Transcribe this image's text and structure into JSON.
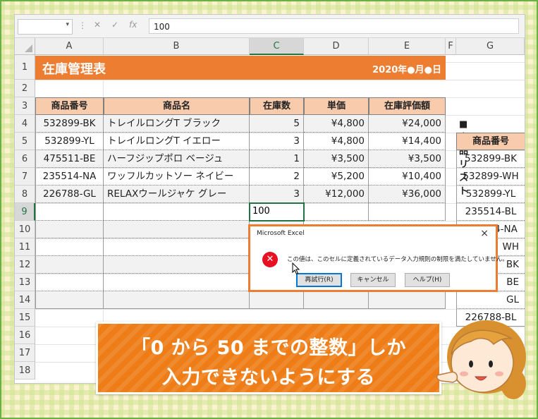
{
  "formula_bar": {
    "name_box": "",
    "formula": "100",
    "fx_label": "fx"
  },
  "columns": [
    "A",
    "B",
    "C",
    "D",
    "E",
    "F",
    "G"
  ],
  "rows": [
    "1",
    "2",
    "3",
    "4",
    "5",
    "6",
    "7",
    "8",
    "9",
    "10",
    "11",
    "12",
    "13",
    "14",
    "15",
    "16",
    "17",
    "18"
  ],
  "sheet": {
    "title": "在庫管理表",
    "date": "2020年●月●日",
    "headers": [
      "商品番号",
      "商品名",
      "在庫数",
      "単価",
      "在庫評価額"
    ],
    "data_rows": [
      [
        "532899-BK",
        "トレイルロングT ブラック",
        "5",
        "¥4,800",
        "¥24,000"
      ],
      [
        "532899-YL",
        "トレイルロングT イエロー",
        "3",
        "¥4,800",
        "¥14,400"
      ],
      [
        "475511-BE",
        "ハーフジップポロ ベージュ",
        "1",
        "¥3,500",
        "¥3,500"
      ],
      [
        "235514-NA",
        "ワッフルカットソー ネイビー",
        "2",
        "¥5,200",
        "¥10,400"
      ],
      [
        "226788-GL",
        "RELAXウールジャケ グレー",
        "3",
        "¥12,000",
        "¥36,000"
      ]
    ],
    "active_cell_value": "100"
  },
  "product_list": {
    "title": "■商品リスト",
    "header": "商品番号",
    "items": [
      "532899-BK",
      "532899-WH",
      "532899-YL",
      "235514-BL",
      "235514-NA",
      "",
      "",
      "",
      "",
      ""
    ],
    "partial_items": [
      "WH",
      "BK",
      "BE",
      "GL"
    ],
    "last_item": "226788-BL"
  },
  "dialog": {
    "title": "Microsoft Excel",
    "close": "×",
    "message": "この値は、このセルに定義されているデータ入力規則の制限を満たしていません。",
    "buttons": {
      "retry": "再試行(R)",
      "cancel": "キャンセル",
      "help": "ヘルプ(H)"
    }
  },
  "banner": {
    "line1": "「0 から 50 までの整数」しか",
    "line2": "入力できないようにする"
  },
  "colors": {
    "accent": "#ed7d31",
    "header_fill": "#f8cbad",
    "excel_green": "#217346",
    "error_red": "#e81123"
  }
}
